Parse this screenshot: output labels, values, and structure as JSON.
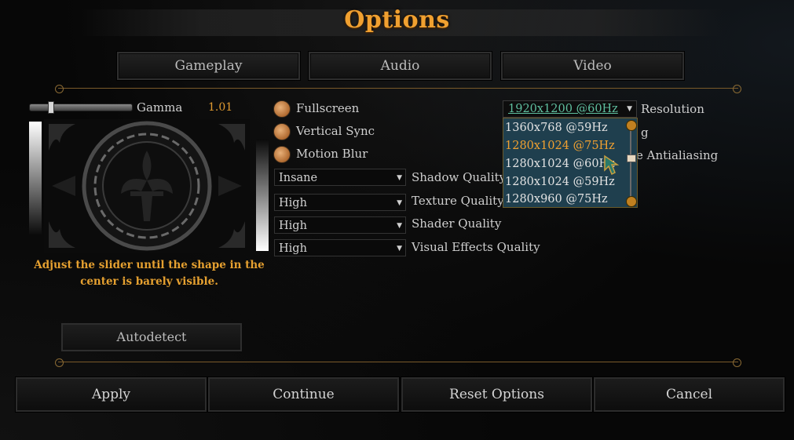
{
  "title": "Options",
  "tabs": [
    {
      "label": "Gameplay"
    },
    {
      "label": "Audio"
    },
    {
      "label": "Video"
    }
  ],
  "gamma": {
    "label": "Gamma",
    "value": "1.01",
    "help": "Adjust the slider until the shape in the center is barely visible."
  },
  "autodetect_label": "Autodetect",
  "toggles": [
    {
      "label": "Fullscreen"
    },
    {
      "label": "Vertical Sync"
    },
    {
      "label": "Motion Blur"
    }
  ],
  "quality": [
    {
      "value": "Insane",
      "label": "Shadow Quality"
    },
    {
      "value": "High",
      "label": "Texture Quality"
    },
    {
      "value": "High",
      "label": "Shader Quality"
    },
    {
      "value": "High",
      "label": "Visual Effects Quality"
    }
  ],
  "resolution": {
    "selected": "1920x1200 @60Hz",
    "label": "Resolution",
    "options": [
      "1360x768 @59Hz",
      "1280x1024 @75Hz",
      "1280x1024 @60Hz",
      "1280x1024 @59Hz",
      "1280x960 @75Hz"
    ],
    "highlighted": "1280x1024 @75Hz"
  },
  "partially_hidden": {
    "row2": "g",
    "row3": "e Antialiasing"
  },
  "buttons": {
    "apply": "Apply",
    "continue": "Continue",
    "reset": "Reset Options",
    "cancel": "Cancel"
  },
  "colors": {
    "accent": "#f0a030",
    "selected_resolution": "#5fbf9f",
    "dropdown_list_bg": "#1f3f4e"
  },
  "icons": {
    "cursor": "pointer-cursor-icon",
    "gamma_pattern": "fleur-de-lis-icon"
  }
}
